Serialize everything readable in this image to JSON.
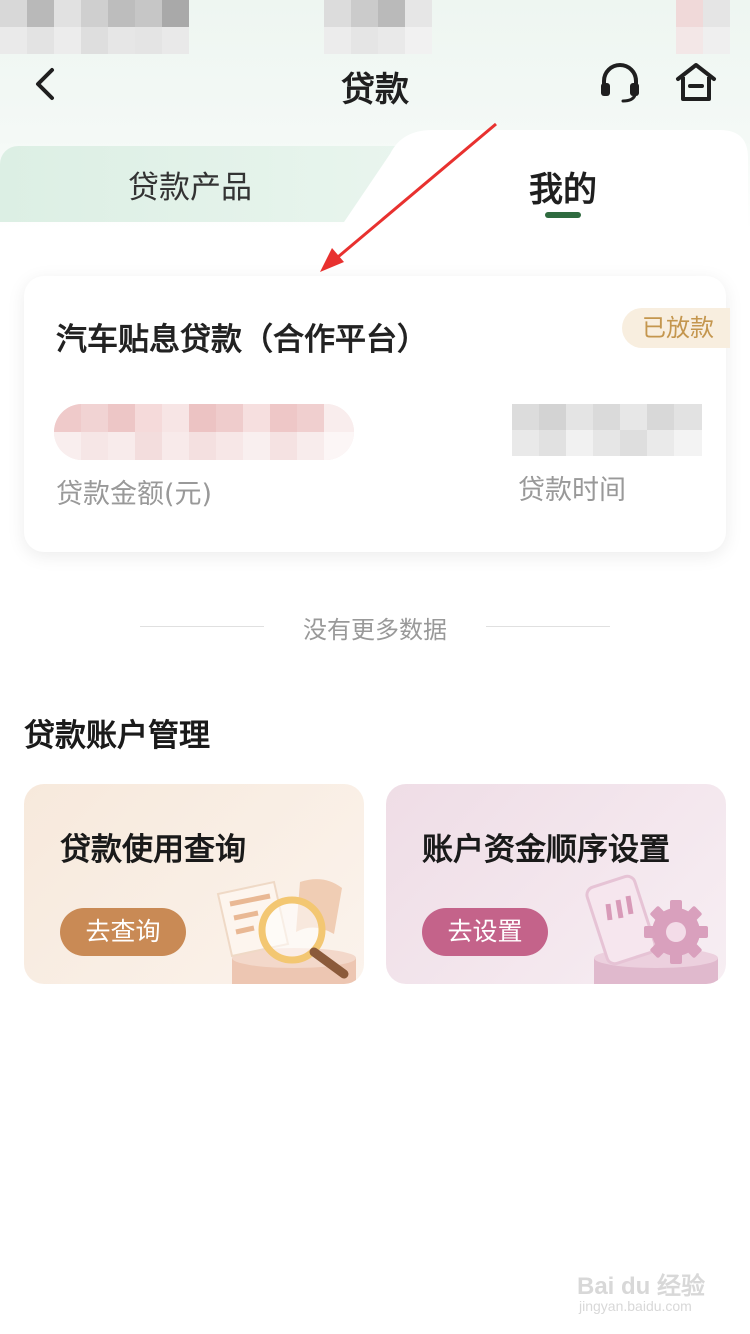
{
  "header": {
    "title": "贷款",
    "back_icon": "chevron-left-icon",
    "service_icon": "headset-icon",
    "home_icon": "home-icon"
  },
  "tabs": [
    {
      "label": "贷款产品",
      "active": false
    },
    {
      "label": "我的",
      "active": true
    }
  ],
  "loan": {
    "name": "汽车贴息贷款（合作平台）",
    "status": "已放款",
    "amount_label": "贷款金额(元)",
    "time_label": "贷款时间"
  },
  "no_more": "没有更多数据",
  "management": {
    "title": "贷款账户管理",
    "cards": [
      {
        "title": "贷款使用查询",
        "button": "去查询",
        "icon": "document-search-icon"
      },
      {
        "title": "账户资金顺序设置",
        "button": "去设置",
        "icon": "phone-gear-icon"
      }
    ]
  },
  "watermark": {
    "text": "Bai du 经验",
    "sub": "jingyan.baidu.com"
  },
  "colors": {
    "accent_green": "#2f6b3f",
    "badge_text": "#c4964e",
    "query_button": "#c98a55",
    "setting_button": "#c4638a",
    "annotation_arrow": "#e8312f"
  }
}
